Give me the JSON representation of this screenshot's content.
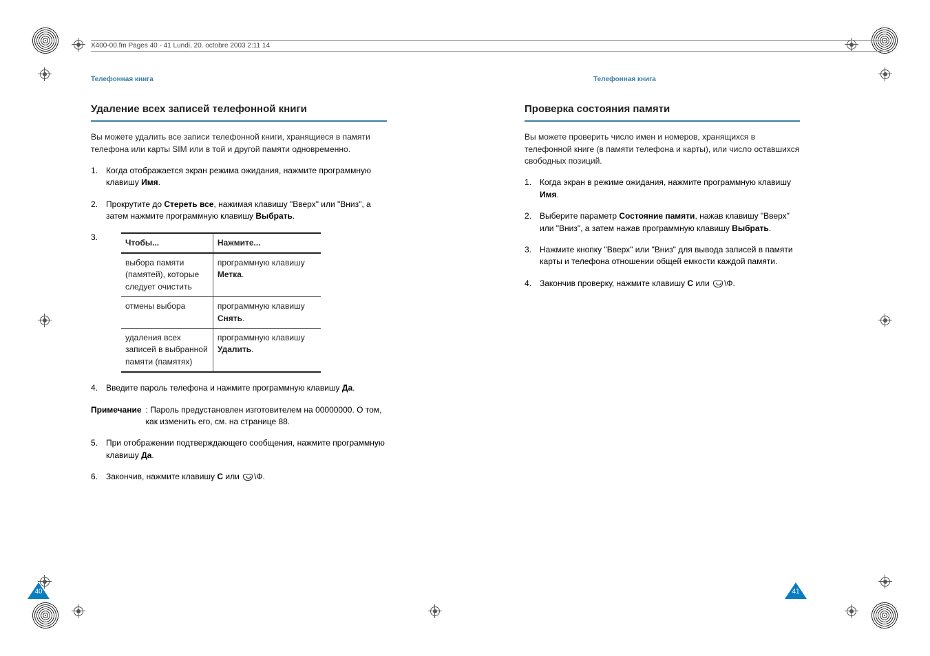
{
  "file_header": "X400-00.fm  Pages 40 - 41  Lundi, 20. octobre 2003  2:11 14",
  "section_label_left": "Телефонная книга",
  "section_label_right": "Телефонная книга",
  "page_left_number": "40",
  "page_right_number": "41",
  "left": {
    "heading": "Удаление всех записей телефонной книги",
    "intro": "Вы можете удалить все записи телефонной книги, хранящиеся в памяти телефона или карты SIM или в той и другой памяти одновременно.",
    "step1_pre": "Когда отображается экран режима ожидания, нажмите программную клавишу ",
    "step1_bold": "Имя",
    "step1_post": ".",
    "step2_pre": "Прокрутите до ",
    "step2_bold": "Стереть все",
    "step2_mid": ", нажимая клавишу \"Вверх\" или \"Вниз\", а затем нажмите программную клавишу ",
    "step2_bold2": "Выбрать",
    "step2_post": ".",
    "step3_label": "3.",
    "table": {
      "h1": "Чтобы...",
      "h2": "Нажмите...",
      "r1c1": "выбора памяти (памятей), которые следует очистить",
      "r1c2_pre": "программную клавишу ",
      "r1c2_bold": "Метка",
      "r1c2_post": ".",
      "r2c1": "отмены выбора",
      "r2c2_pre": "программную клавишу ",
      "r2c2_bold": "Снять",
      "r2c2_post": ".",
      "r3c1": "удаления всех записей в выбранной памяти (памятях)",
      "r3c2_pre": "программную клавишу ",
      "r3c2_bold": "Удалить",
      "r3c2_post": "."
    },
    "step4_pre": "Введите пароль телефона и нажмите программную клавишу ",
    "step4_bold": "Да",
    "step4_post": ".",
    "note_label": "Примечание",
    "note_body": ": Пароль предустановлен изготовителем на 00000000. О том, как изменить его, см. на странице 88.",
    "step5_pre": "При отображении подтверждающего сообщения, нажмите программную клавишу ",
    "step5_bold": "Да",
    "step5_post": ".",
    "step6_pre": "Закончив, нажмите клавишу ",
    "step6_bold": "C",
    "step6_mid": " или ",
    "step6_post": "\\Ф."
  },
  "right": {
    "heading": "Проверка состояния памяти",
    "intro": "Вы можете проверить число имен и номеров, хранящихся в телефонной книге (в памяти телефона и карты), или число оставшихся свободных позиций.",
    "step1_pre": "Когда экран в режиме ожидания, нажмите программную клавишу ",
    "step1_bold": "Имя",
    "step1_post": ".",
    "step2_pre": "Выберите параметр ",
    "step2_bold": "Состояние памяти",
    "step2_mid": ", нажав клавишу \"Вверх\" или \"Вниз\", а затем нажав программную клавишу ",
    "step2_bold2": "Выбрать",
    "step2_post": ".",
    "step3": "Нажмите кнопку \"Вверх\" или \"Вниз\" для вывода записей в памяти карты и телефона отношении общей емкости каждой памяти.",
    "step4_pre": "Закончив проверку, нажмите клавишу ",
    "step4_bold": "C",
    "step4_mid": " или ",
    "step4_post": "\\Ф."
  }
}
